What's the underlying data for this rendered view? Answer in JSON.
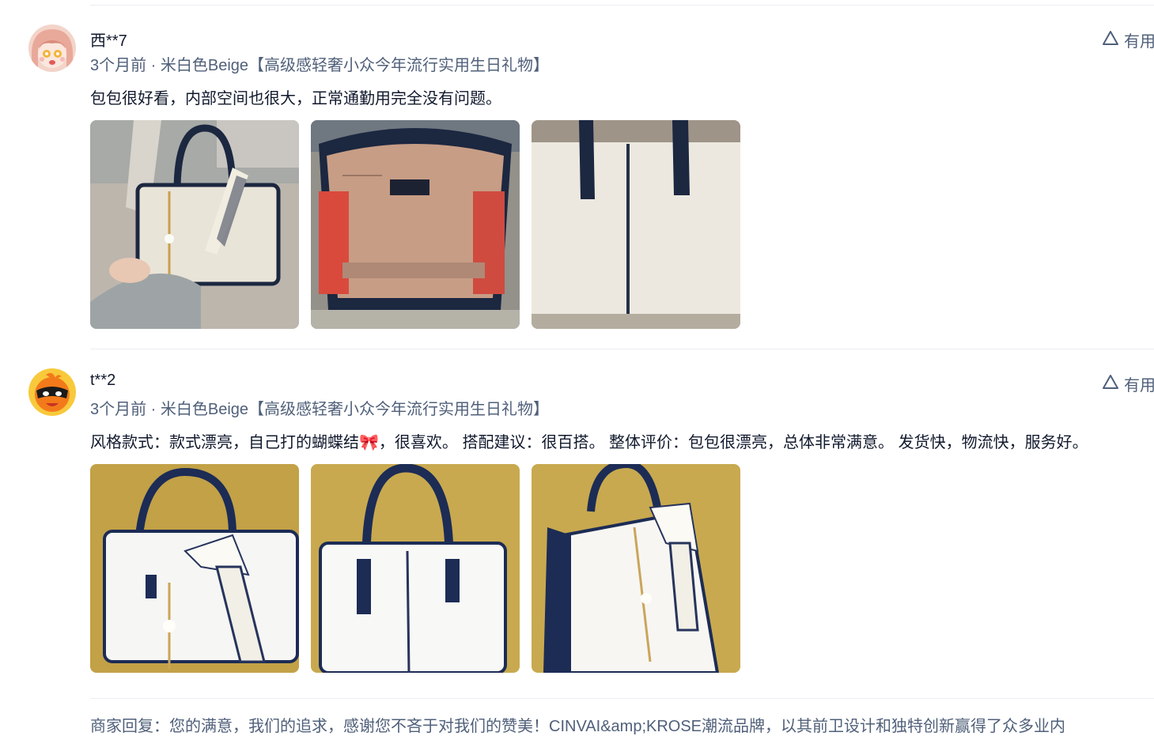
{
  "reviews": [
    {
      "username": "西**7",
      "time": "3个月前",
      "separator": " · ",
      "variant": "米白色Beige【高级感轻奢小众今年流行实用生日礼物】",
      "text": "包包很好看，内部空间也很大，正常通勤用完全没有问题。",
      "helpful_label": "有用",
      "avatar_icon": "anime-girl-avatar",
      "photos": [
        "handbag-with-scarf-photo",
        "handbag-interior-photo",
        "handbag-back-photo"
      ]
    },
    {
      "username": "t**2",
      "time": "3个月前",
      "separator": " · ",
      "variant": "米白色Beige【高级感轻奢小众今年流行实用生日礼物】",
      "text": "风格款式：款式漂亮，自己打的蝴蝶结🎀，很喜欢。 搭配建议：很百搭。 整体评价：包包很漂亮，总体非常满意。 发货快，物流快，服务好。",
      "helpful_label": "有用",
      "avatar_icon": "orange-masked-mascot-avatar",
      "photos": [
        "handbag-front-bow-photo",
        "handbag-plain-front-photo",
        "handbag-side-bow-photo"
      ]
    }
  ],
  "merchant_reply": "商家回复：您的满意，我们的追求，感谢您不吝于对我们的赞美！CINVAI&amp;KROSE潮流品牌，以其前卫设计和独特创新赢得了众多业内",
  "colors": {
    "primary_text": "#11192d",
    "secondary_text": "#50607a",
    "divider": "#eceef2"
  }
}
